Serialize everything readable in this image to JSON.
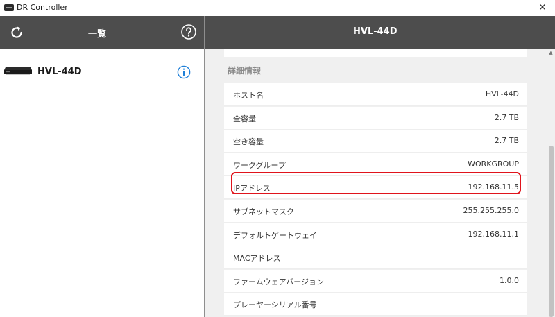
{
  "window": {
    "title": "DR Controller",
    "close_glyph": "✕"
  },
  "left_header": {
    "title": "一覧",
    "refresh_icon": "refresh-icon",
    "help_icon": "help-icon"
  },
  "right_header": {
    "title": "HVL-44D"
  },
  "device_list": [
    {
      "name": "HVL-44D",
      "icon": "nas-device-icon",
      "info_icon": "info-icon"
    }
  ],
  "details": {
    "section_title": "詳細情報",
    "rows": [
      {
        "label": "ホスト名",
        "value": "HVL-44D"
      },
      {
        "label": "全容量",
        "value": "2.7 TB"
      },
      {
        "label": "空き容量",
        "value": "2.7 TB"
      },
      {
        "label": "ワークグループ",
        "value": "WORKGROUP"
      },
      {
        "label": "IPアドレス",
        "value": "192.168.11.5"
      },
      {
        "label": "サブネットマスク",
        "value": "255.255.255.0"
      },
      {
        "label": "デフォルトゲートウェイ",
        "value": "192.168.11.1"
      },
      {
        "label": "MACアドレス",
        "value": ""
      },
      {
        "label": "ファームウェアバージョン",
        "value": "1.0.0"
      },
      {
        "label": "プレーヤーシリアル番号",
        "value": ""
      }
    ],
    "highlighted_row": "IPアドレス",
    "highlight_color": "#e0141c"
  },
  "colors": {
    "header_bg": "#4d4d4d",
    "pane_bg": "#f0f0f0",
    "info_blue": "#1e7fd8"
  }
}
